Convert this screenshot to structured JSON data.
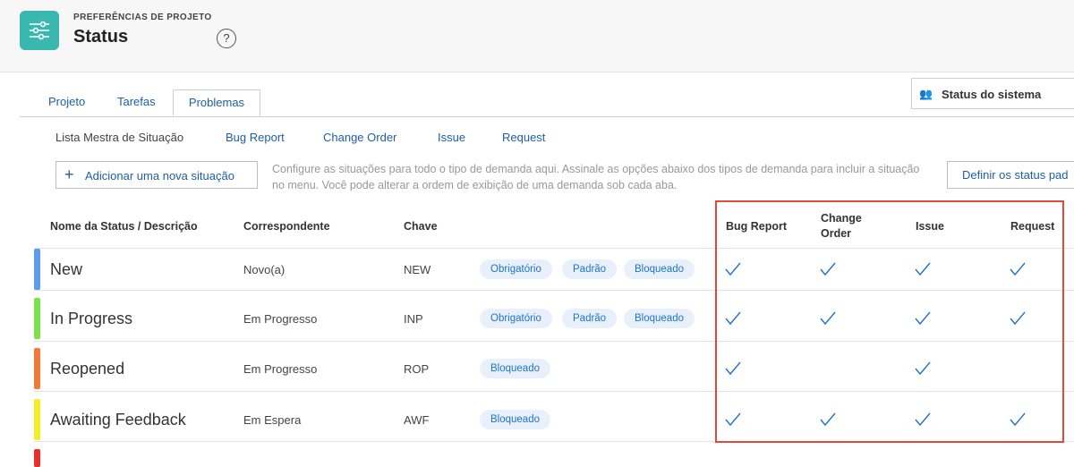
{
  "header": {
    "eyebrow": "PREFERÊNCIAS DE PROJETO",
    "title": "Status",
    "help_glyph": "?",
    "app_icon": "sliders-icon"
  },
  "tabs": [
    {
      "label": "Projeto",
      "active": false
    },
    {
      "label": "Tarefas",
      "active": false
    },
    {
      "label": "Problemas",
      "active": true
    }
  ],
  "system_status": {
    "label": "Status do sistema",
    "icon": "people-icon"
  },
  "subnav": [
    "Lista Mestra de Situação",
    "Bug Report",
    "Change Order",
    "Issue",
    "Request"
  ],
  "add_button": {
    "label": "Adicionar uma nova situação"
  },
  "help_text": "Configure as situações para todo o tipo de demanda aqui. Assinale as opções abaixo dos tipos de demanda para incluir a situação no menu. Você pode alterar a ordem de exibição de uma demanda sob cada aba.",
  "define_button": {
    "label": "Definir os status pad"
  },
  "table": {
    "headers": {
      "name": "Nome da Status / Descrição",
      "match": "Correspondente",
      "key": "Chave",
      "bug_report": "Bug Report",
      "change_order_1": "Change",
      "change_order_2": "Order",
      "issue": "Issue",
      "request": "Request"
    },
    "rows": [
      {
        "name": "New",
        "match": "Novo(a)",
        "key": "NEW",
        "color": "#5b9cf0",
        "badges": [
          "Obrigatório",
          "Padrão",
          "Bloqueado"
        ],
        "checks": [
          true,
          true,
          true,
          true
        ]
      },
      {
        "name": "In Progress",
        "match": "Em Progresso",
        "key": "INP",
        "color": "#7ee04a",
        "badges": [
          "Obrigatório",
          "Padrão",
          "Bloqueado"
        ],
        "checks": [
          true,
          true,
          true,
          true
        ]
      },
      {
        "name": "Reopened",
        "match": "Em Progresso",
        "key": "ROP",
        "color": "#f07a36",
        "badges": [
          "Bloqueado"
        ],
        "checks": [
          true,
          false,
          true,
          false
        ]
      },
      {
        "name": "Awaiting Feedback",
        "match": "Em Espera",
        "key": "AWF",
        "color": "#f2ee2a",
        "badges": [
          "Bloqueado"
        ],
        "checks": [
          true,
          true,
          true,
          true
        ]
      }
    ],
    "partial_row_color": "#e8302e"
  },
  "colors": {
    "accent": "#1e73c8",
    "brand": "#3ab8b0",
    "highlight": "#e04b35"
  }
}
